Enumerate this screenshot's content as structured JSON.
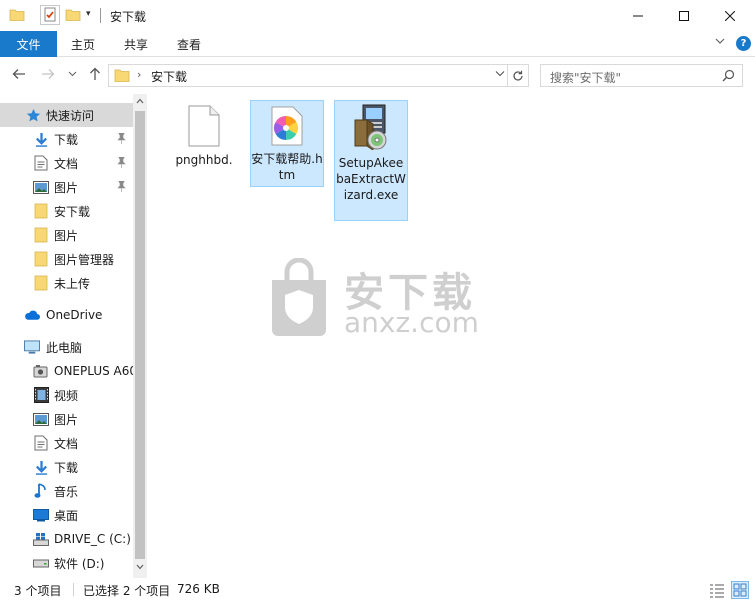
{
  "window": {
    "title": "安下载"
  },
  "ribbon": {
    "tabs": [
      {
        "label": "文件"
      },
      {
        "label": "主页"
      },
      {
        "label": "共享"
      },
      {
        "label": "查看"
      }
    ],
    "help": "?"
  },
  "nav": {
    "address": {
      "path": "安下载"
    },
    "search": {
      "placeholder": "搜索\"安下载\""
    }
  },
  "sidebar": {
    "items": [
      {
        "label": "快速访问",
        "icon": "star-icon"
      },
      {
        "label": "下载",
        "icon": "download-arrow-icon",
        "pinned": true
      },
      {
        "label": "文档",
        "icon": "document-icon",
        "pinned": true
      },
      {
        "label": "图片",
        "icon": "picture-icon",
        "pinned": true
      },
      {
        "label": "安下载",
        "icon": "folder-icon"
      },
      {
        "label": "图片",
        "icon": "folder-icon"
      },
      {
        "label": "图片管理器",
        "icon": "folder-icon"
      },
      {
        "label": "未上传",
        "icon": "folder-icon"
      },
      {
        "label": "OneDrive",
        "icon": "cloud-icon"
      },
      {
        "label": "此电脑",
        "icon": "computer-icon"
      },
      {
        "label": "ONEPLUS A60",
        "icon": "phone-icon"
      },
      {
        "label": "视频",
        "icon": "video-icon"
      },
      {
        "label": "图片",
        "icon": "picture-icon"
      },
      {
        "label": "文档",
        "icon": "document-icon"
      },
      {
        "label": "下载",
        "icon": "download-arrow-icon"
      },
      {
        "label": "音乐",
        "icon": "music-note-icon"
      },
      {
        "label": "桌面",
        "icon": "desktop-icon"
      },
      {
        "label": "DRIVE_C (C:)",
        "icon": "windows-drive-icon"
      },
      {
        "label": "软件 (D:)",
        "icon": "drive-icon"
      }
    ]
  },
  "files": [
    {
      "name": "pnghhbd.",
      "icon": "blank-file-icon",
      "selected": false
    },
    {
      "name": "安下载帮助.htm",
      "icon": "colorful-pinwheel-icon",
      "selected": true
    },
    {
      "name": "SetupAkeebaExtractWizard.exe",
      "icon": "installer-icon",
      "selected": true
    }
  ],
  "watermark": {
    "text": "安下载",
    "sub": "anxz.com",
    "shield_char": "安"
  },
  "status": {
    "count": "3 个项目",
    "selected": "已选择 2 个项目",
    "size": "726 KB"
  },
  "colors": {
    "accent": "#1979ca",
    "selection": "#cce8ff",
    "selection_border": "#99d1ff",
    "folder": "#f8d775"
  }
}
